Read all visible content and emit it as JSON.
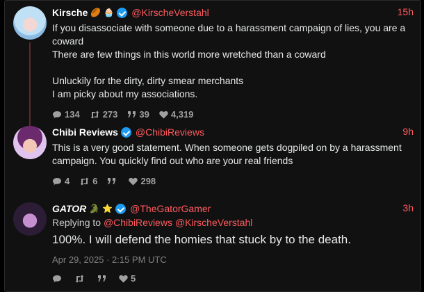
{
  "tweets": [
    {
      "name": "Kirsche",
      "emojis": [
        "🏉",
        "🧁"
      ],
      "verified": true,
      "handle": "@KirscheVerstahl",
      "time": "15h",
      "body": "If you disassociate with someone due to a harassment campaign of lies, you are a coward\nThere are few things in this world more wretched than a coward\n\nUnluckily for the dirty, dirty smear merchants\nI am picky about my associations.",
      "stats": {
        "replies": "134",
        "retweets": "273",
        "quotes": "39",
        "likes": "4,319"
      }
    },
    {
      "name": "Chibi Reviews",
      "verified": true,
      "handle": "@ChibiReviews",
      "time": "9h",
      "body": "This is a very good statement. When someone gets dogpiled on by a harassment campaign. You quickly find out who are your real friends",
      "stats": {
        "replies": "4",
        "retweets": "6",
        "quotes": "",
        "likes": "298"
      }
    },
    {
      "name": "GATOR",
      "emojis": [
        "🐊",
        "⭐"
      ],
      "verified": true,
      "handle": "@TheGatorGamer",
      "time": "3h",
      "replying_prefix": "Replying to",
      "replying_to": [
        "@ChibiReviews",
        "@KirscheVerstahl"
      ],
      "body": "100%. I will defend the homies that stuck by to the death.",
      "date": "Apr 29, 2025 · 2:15 PM UTC",
      "stats": {
        "replies": "",
        "retweets": "",
        "quotes": "",
        "likes": "5"
      }
    }
  ],
  "colors": {
    "accent": "#ff5a5f",
    "verified": "#1d9bf0",
    "background": "#111111"
  },
  "icons": {
    "reply": "comment-icon",
    "retweet": "retweet-icon",
    "quote": "quote-icon",
    "like": "heart-icon"
  }
}
